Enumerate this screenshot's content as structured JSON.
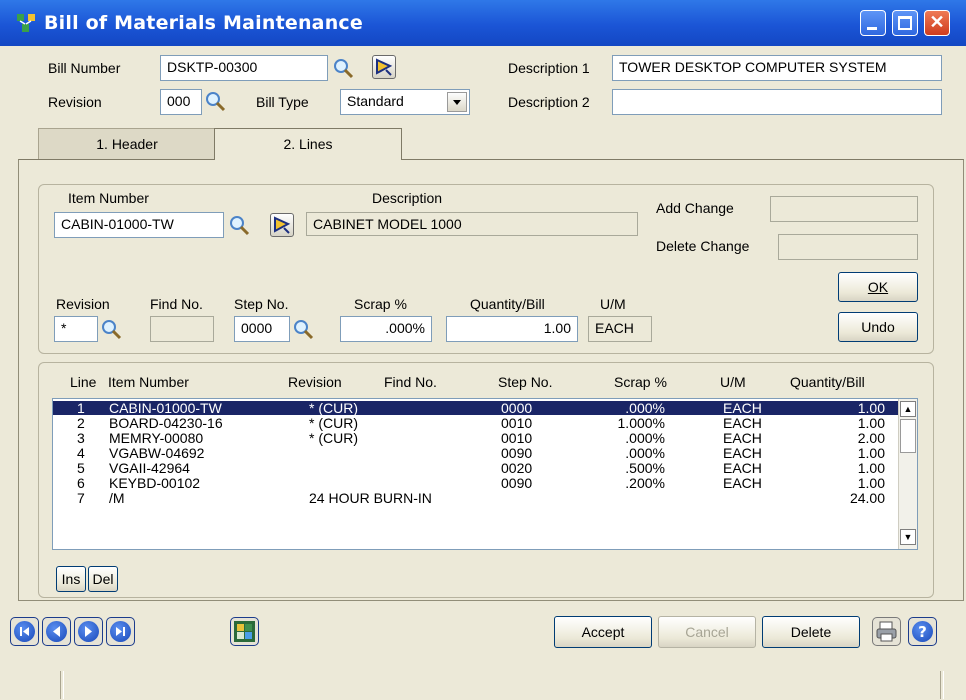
{
  "window": {
    "title": "Bill of Materials Maintenance",
    "app_icon": "bom-app-icon"
  },
  "header": {
    "bill_number_label": "Bill Number",
    "bill_number_value": "DSKTP-00300",
    "revision_label": "Revision",
    "revision_value": "000",
    "bill_type_label": "Bill Type",
    "bill_type_value": "Standard",
    "desc1_label": "Description 1",
    "desc1_value": "TOWER DESKTOP COMPUTER SYSTEM",
    "desc2_label": "Description 2",
    "desc2_value": ""
  },
  "tabs": [
    {
      "label": "1. Header",
      "active": false
    },
    {
      "label": "2. Lines",
      "active": true
    }
  ],
  "line_entry": {
    "item_number_label": "Item Number",
    "item_number_value": "CABIN-01000-TW",
    "description_label": "Description",
    "description_value": "CABINET MODEL 1000",
    "add_change_label": "Add Change",
    "add_change_value": "",
    "delete_change_label": "Delete Change",
    "delete_change_value": "",
    "revision_label": "Revision",
    "revision_value": "*",
    "find_no_label": "Find No.",
    "find_no_value": "",
    "step_no_label": "Step No.",
    "step_no_value": "0000",
    "scrap_label": "Scrap %",
    "scrap_value": ".000%",
    "qty_bill_label": "Quantity/Bill",
    "qty_bill_value": "1.00",
    "um_label": "U/M",
    "um_value": "EACH",
    "ok_label": "OK",
    "undo_label": "Undo"
  },
  "grid": {
    "columns": [
      "Line",
      "Item Number",
      "Revision",
      "Find No.",
      "Step No.",
      "Scrap %",
      "U/M",
      "Quantity/Bill"
    ],
    "rows": [
      {
        "line": "1",
        "item": "CABIN-01000-TW",
        "revision": "*  (CUR)",
        "find": "",
        "step": "0000",
        "scrap": ".000%",
        "um": "EACH",
        "qty": "1.00"
      },
      {
        "line": "2",
        "item": "BOARD-04230-16",
        "revision": "*  (CUR)",
        "find": "",
        "step": "0010",
        "scrap": "1.000%",
        "um": "EACH",
        "qty": "1.00"
      },
      {
        "line": "3",
        "item": "MEMRY-00080",
        "revision": "*  (CUR)",
        "find": "",
        "step": "0010",
        "scrap": ".000%",
        "um": "EACH",
        "qty": "2.00"
      },
      {
        "line": "4",
        "item": "VGABW-04692",
        "revision": "",
        "find": "",
        "step": "0090",
        "scrap": ".000%",
        "um": "EACH",
        "qty": "1.00"
      },
      {
        "line": "5",
        "item": "VGAII-42964",
        "revision": "",
        "find": "",
        "step": "0020",
        "scrap": ".500%",
        "um": "EACH",
        "qty": "1.00"
      },
      {
        "line": "6",
        "item": "KEYBD-00102",
        "revision": "",
        "find": "",
        "step": "0090",
        "scrap": ".200%",
        "um": "EACH",
        "qty": "1.00"
      },
      {
        "line": "7",
        "item": "/M",
        "revision": "24 HOUR BURN-IN",
        "find": "",
        "step": "",
        "scrap": "",
        "um": "",
        "qty": "24.00"
      }
    ],
    "ins_label": "Ins",
    "del_label": "Del"
  },
  "toolbar": {
    "accept_label": "Accept",
    "cancel_label": "Cancel",
    "delete_label": "Delete"
  },
  "colors": {
    "title_bar": "#1b55d6",
    "selected_row": "#1a2566"
  }
}
